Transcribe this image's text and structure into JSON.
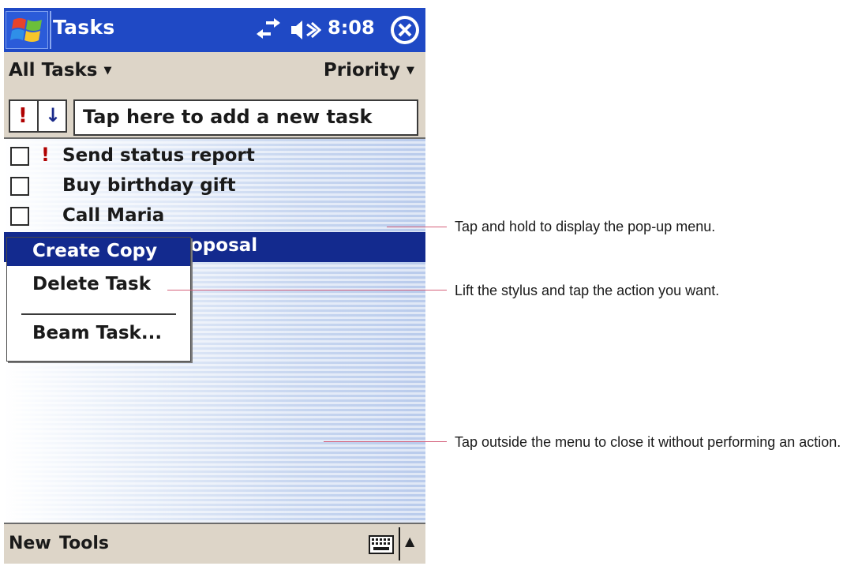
{
  "titlebar": {
    "app_title": "Tasks",
    "clock": "8:08",
    "start_icon": "windows-flag-icon",
    "connectivity_icon": "connectivity-arrows-icon",
    "volume_icon": "speaker-icon",
    "close_icon": "close-circle-x-icon"
  },
  "filterbar": {
    "category_filter": "All Tasks",
    "sort_by": "Priority"
  },
  "entrybar": {
    "priority_high_glyph": "!",
    "priority_low_glyph": "↓",
    "new_task_placeholder": "Tap here to add a new task"
  },
  "tasks": [
    {
      "name": "Send status report",
      "high_priority": true,
      "completed": false
    },
    {
      "name": "Buy birthday gift",
      "high_priority": false,
      "completed": false
    },
    {
      "name": "Call Maria",
      "high_priority": false,
      "completed": false
    },
    {
      "name": "oposal",
      "high_priority": false,
      "completed": false,
      "selected": true
    }
  ],
  "popup_menu": {
    "items": [
      "Create Copy",
      "Delete Task",
      "Beam Task..."
    ],
    "active_item": "Create Copy"
  },
  "bottombar": {
    "menu_new": "New",
    "menu_tools": "Tools",
    "keyboard_icon": "keyboard-icon",
    "sip_arrow": "▲"
  },
  "callouts": [
    "Tap and hold to display the pop-up menu.",
    "Lift the stylus and tap the action you want.",
    "Tap outside the menu to close it without performing an action."
  ],
  "colors": {
    "titlebar_bg": "#1f49c5",
    "bar_bg": "#ddd5c8",
    "selection_bg": "#132a8e",
    "priority_red": "#b00000",
    "callout_line": "#d4607a"
  }
}
